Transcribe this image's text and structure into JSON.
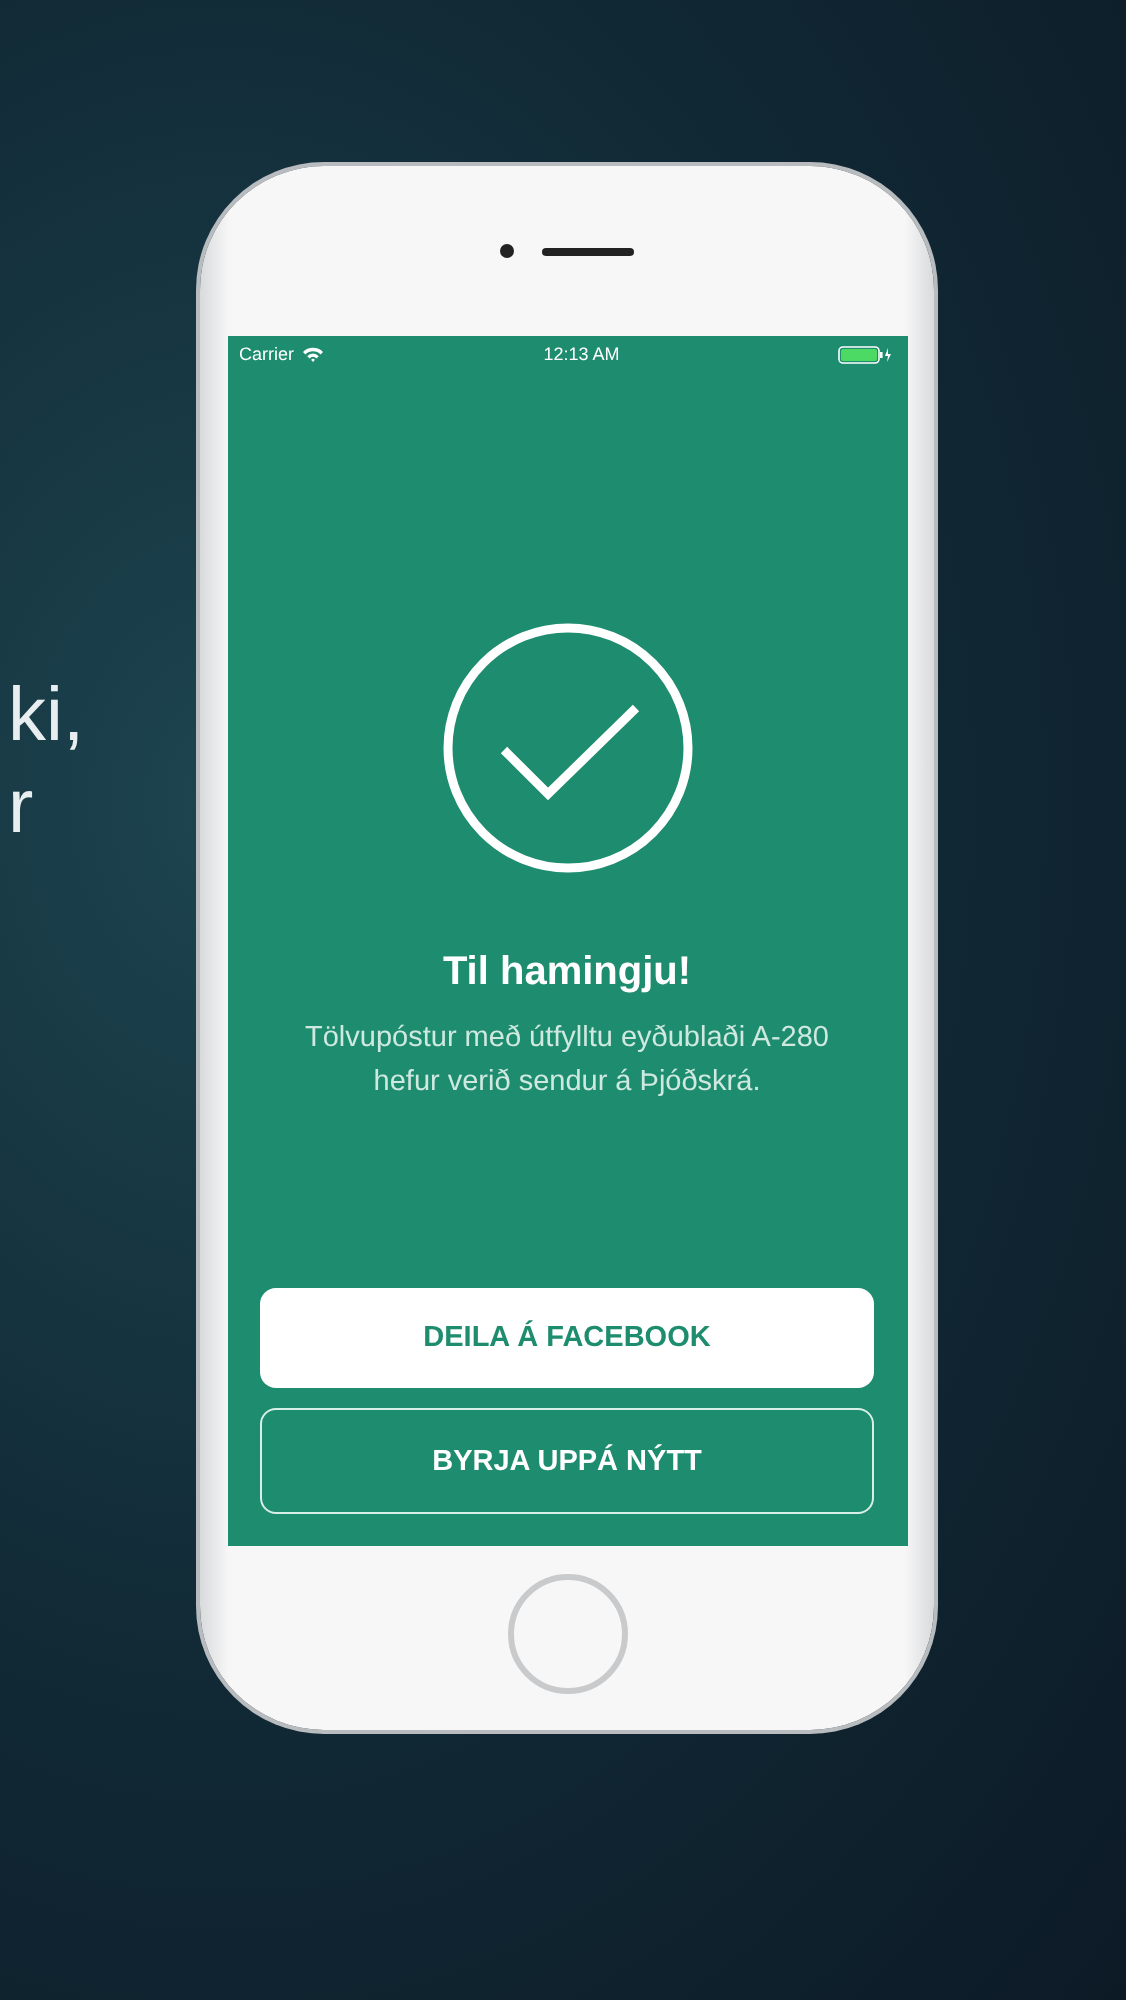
{
  "side_text": [
    "ki,",
    "r"
  ],
  "status_bar": {
    "carrier": "Carrier",
    "time": "12:13 AM"
  },
  "title": "Til hamingju!",
  "message": "Tölvupóstur með útfylltu eyðublaði A-280 hefur verið sendur á Þjóðskrá.",
  "buttons": [
    {
      "label": "DEILA Á FACEBOOK",
      "kind": "filled"
    },
    {
      "label": "BYRJA UPPÁ NÝTT",
      "kind": "outline"
    }
  ]
}
